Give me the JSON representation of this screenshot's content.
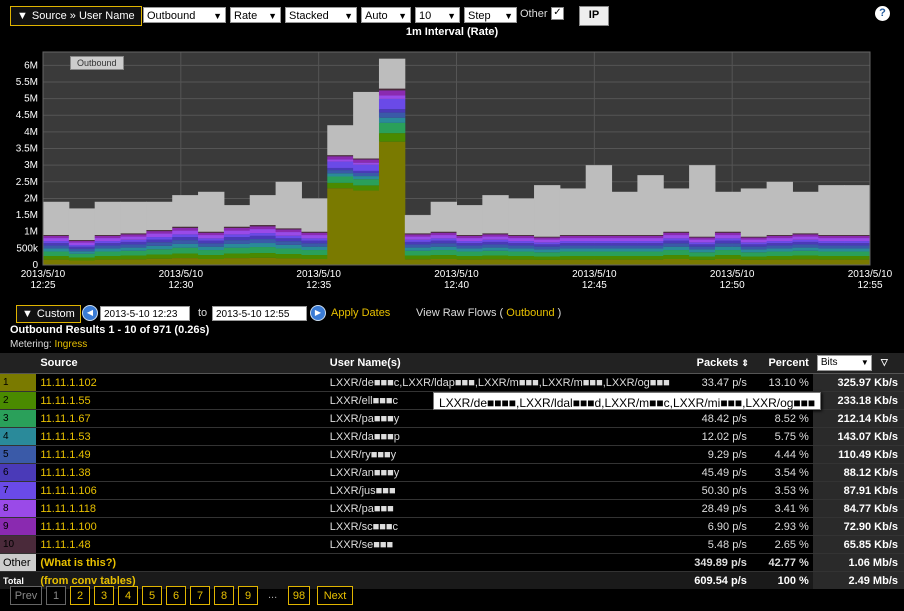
{
  "header": {
    "source_button": "Source » User Name",
    "filters": [
      {
        "value": "Outbound"
      },
      {
        "value": "Rate"
      },
      {
        "value": "Stacked"
      },
      {
        "value": "Auto"
      },
      {
        "value": "10"
      },
      {
        "value": "Step"
      }
    ],
    "other_label": "Other",
    "other_checked": "✓",
    "ip_button": "IP",
    "help": "?"
  },
  "chart": {
    "title": "1m Interval (Rate)",
    "legend_badge": "Outbound"
  },
  "chart_data": {
    "type": "area",
    "stacking": "stacked-step",
    "ylim": [
      0,
      6400000
    ],
    "yticks": [
      "0",
      "500k",
      "1M",
      "1.5M",
      "2M",
      "2.5M",
      "3M",
      "3.5M",
      "4M",
      "4.5M",
      "5M",
      "5.5M",
      "6M"
    ],
    "ytick_values": [
      0,
      500000,
      1000000,
      1500000,
      2000000,
      2500000,
      3000000,
      3500000,
      4000000,
      4500000,
      5000000,
      5500000,
      6000000
    ],
    "xticks": [
      {
        "line1": "2013/5/10",
        "line2": "12:25"
      },
      {
        "line1": "2013/5/10",
        "line2": "12:30"
      },
      {
        "line1": "2013/5/10",
        "line2": "12:35"
      },
      {
        "line1": "2013/5/10",
        "line2": "12:40"
      },
      {
        "line1": "2013/5/10",
        "line2": "12:45"
      },
      {
        "line1": "2013/5/10",
        "line2": "12:50"
      },
      {
        "line1": "2013/5/10",
        "line2": "12:55"
      }
    ],
    "colors": [
      "#7a7a00",
      "#4a8a00",
      "#2aa05a",
      "#2a8a9a",
      "#3a5aa8",
      "#4a3ab8",
      "#6a4ae8",
      "#9a4ae8",
      "#8a2ab0",
      "#4a2a3a",
      "#bdbdbd"
    ],
    "series_names": [
      "1",
      "2",
      "3",
      "4",
      "5",
      "6",
      "7",
      "8",
      "9",
      "10",
      "Other"
    ],
    "bins": 32,
    "totals": [
      1.9,
      1.7,
      1.9,
      1.9,
      1.9,
      2.1,
      2.2,
      1.8,
      2.1,
      2.5,
      2.0,
      4.2,
      5.2,
      6.2,
      1.5,
      1.9,
      1.8,
      2.1,
      2.0,
      2.4,
      2.3,
      3.0,
      2.2,
      2.7,
      2.3,
      3.0,
      2.2,
      2.3,
      2.5,
      2.2,
      2.4,
      2.4
    ],
    "colored_top": [
      0.9,
      0.75,
      0.9,
      0.95,
      1.05,
      1.15,
      1.0,
      1.15,
      1.2,
      1.1,
      1.0,
      3.3,
      3.2,
      5.3,
      0.95,
      1.0,
      0.9,
      0.95,
      0.9,
      0.85,
      0.9,
      0.9,
      0.9,
      0.9,
      1.0,
      0.85,
      1.0,
      0.85,
      0.9,
      0.95,
      0.9,
      0.9
    ]
  },
  "controls": {
    "range_button": "Custom",
    "from_date": "2013-5-10 12:23",
    "to_label": "to",
    "to_date": "2013-5-10 12:55",
    "apply": "Apply Dates",
    "view_raw_prefix": "View Raw Flows (",
    "view_raw_link": "Outbound",
    "view_raw_suffix": ")",
    "results_text": "Outbound Results 1 - 10 of 971 (0.26s)",
    "metering_label": "Metering:",
    "metering_value": "Ingress"
  },
  "table": {
    "headers": {
      "source": "Source",
      "user": "User Name(s)",
      "packets": "Packets",
      "percent": "Percent",
      "bits": "Bits"
    },
    "rows": [
      {
        "num": "1",
        "color": "#7a7a00",
        "source": "11.11.1.102",
        "user": "LXXR/de■■■c,LXXR/ldap■■■,LXXR/m■■■,LXXR/m■■■,LXXR/og■■■",
        "packets": "33.47 p/s",
        "percent": "13.10 %",
        "bits": "325.97 Kb/s"
      },
      {
        "num": "2",
        "color": "#4a8a00",
        "source": "11.11.1.55",
        "user": "LXXR/ell■■■c",
        "packets": "",
        "percent": "7 %",
        "bits": "233.18 Kb/s"
      },
      {
        "num": "3",
        "color": "#2aa05a",
        "source": "11.11.1.67",
        "user": "LXXR/pa■■■y",
        "packets": "48.42 p/s",
        "percent": "8.52 %",
        "bits": "212.14 Kb/s"
      },
      {
        "num": "4",
        "color": "#2a8a9a",
        "source": "11.11.1.53",
        "user": "LXXR/da■■■p",
        "packets": "12.02 p/s",
        "percent": "5.75 %",
        "bits": "143.07 Kb/s"
      },
      {
        "num": "5",
        "color": "#3a5aa8",
        "source": "11.11.1.49",
        "user": "LXXR/ry■■■y",
        "packets": "9.29 p/s",
        "percent": "4.44 %",
        "bits": "110.49 Kb/s"
      },
      {
        "num": "6",
        "color": "#4a3ab8",
        "source": "11.11.1.38",
        "user": "LXXR/an■■■y",
        "packets": "45.49 p/s",
        "percent": "3.54 %",
        "bits": "88.12 Kb/s"
      },
      {
        "num": "7",
        "color": "#6a4ae8",
        "source": "11.11.1.106",
        "user": "LXXR/jus■■■",
        "packets": "50.30 p/s",
        "percent": "3.53 %",
        "bits": "87.91 Kb/s"
      },
      {
        "num": "8",
        "color": "#9a4ae8",
        "source": "11.11.1.118",
        "user": "LXXR/pa■■■",
        "packets": "28.49 p/s",
        "percent": "3.41 %",
        "bits": "84.77 Kb/s"
      },
      {
        "num": "9",
        "color": "#8a2ab0",
        "source": "11.11.1.100",
        "user": "LXXR/sc■■■c",
        "packets": "6.90 p/s",
        "percent": "2.93 %",
        "bits": "72.90 Kb/s"
      },
      {
        "num": "10",
        "color": "#4a2a3a",
        "source": "11.11.1.48",
        "user": "LXXR/se■■■",
        "packets": "5.48 p/s",
        "percent": "2.65 %",
        "bits": "65.85 Kb/s"
      }
    ],
    "other": {
      "label": "Other",
      "source": "(What is this?)",
      "packets": "349.89 p/s",
      "percent": "42.77 %",
      "bits": "1.06 Mb/s"
    },
    "total": {
      "label": "Total",
      "source": "(from conv tables)",
      "packets": "609.54 p/s",
      "percent": "100 %",
      "bits": "2.49 Mb/s"
    }
  },
  "tooltip": "LXXR/de■■■■,LXXR/ldal■■■d,LXXR/m■■c,LXXR/mi■■■,LXXR/og■■■",
  "pager": {
    "prev": "Prev",
    "pages": [
      "1",
      "2",
      "3",
      "4",
      "5",
      "6",
      "7",
      "8",
      "9"
    ],
    "ellipsis": "...",
    "last": "98",
    "next": "Next"
  }
}
